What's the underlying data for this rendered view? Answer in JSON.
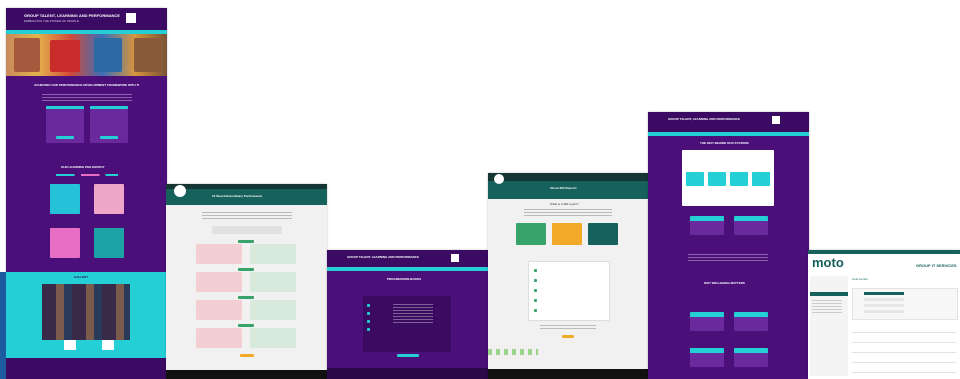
{
  "colors": {
    "purple": "#4b0f7a",
    "purple_dark": "#2f0a52",
    "teal": "#24d0d6",
    "dark_teal": "#123f3d",
    "light_gray": "#f1f1f1",
    "pink": "#f3cfd4",
    "mint": "#d7eadc",
    "orange": "#f2a928",
    "green": "#38a36b"
  },
  "screens": {
    "s1": {
      "title": "GROUP TALENT, LEARNING AND PERFORMANCE",
      "subtitle": "EMBRACING THE POWER OF PEOPLE",
      "hero_heading": "ACHIEVING OUR PERFORMANCE DEVELOPMENT FRAMEWORK WITH TRUSTED TEAMS",
      "section_heading": "OUR LEARNING PHILOSOPHY",
      "gallery_heading": "GALLERY"
    },
    "s2": {
      "title": "10 Step Extraordinary Performance"
    },
    "s3": {
      "title": "GROUP TALENT, LEARNING AND PERFORMANCE",
      "section_heading": "PROGRESSION BOOKS"
    },
    "s4": {
      "title": "About 360 Reports",
      "subheading": "What is a 360 report?"
    },
    "s5": {
      "title": "GROUP TALENT, LEARNING AND PERFORMANCE",
      "section1": "THE WHY BEHIND OUR SYSTEMS",
      "section2": "WHY WELLBEING MATTERS"
    },
    "s6": {
      "logo_text": "moto",
      "header_right": "GROUP IT SERVICES",
      "panel_title": "Cost Centre"
    }
  }
}
